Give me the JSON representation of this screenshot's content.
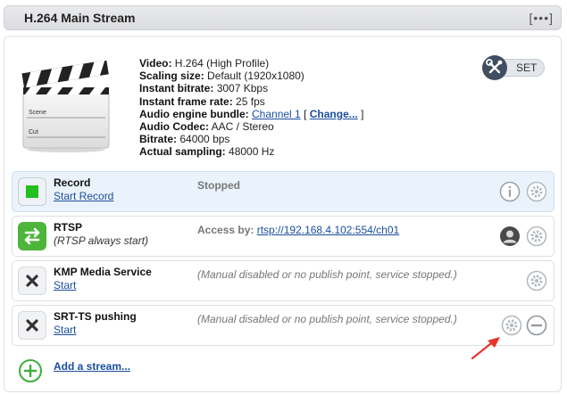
{
  "header": {
    "title": "H.264 Main Stream",
    "menu": "[•••]"
  },
  "clapper": {
    "scene": "Scene",
    "cut": "Cut"
  },
  "info": {
    "video_label": "Video:",
    "video_value": "H.264 (High Profile)",
    "scaling_label": "Scaling size:",
    "scaling_value": "Default (1920x1080)",
    "bitrate_label": "Instant bitrate:",
    "bitrate_value": "3007 Kbps",
    "framerate_label": "Instant frame rate:",
    "framerate_value": "25 fps",
    "audio_bundle_label": "Audio engine bundle:",
    "audio_bundle_link": "Channel 1",
    "audio_bundle_open": "[",
    "audio_bundle_change": "Change...",
    "audio_bundle_close": "]",
    "audio_codec_label": "Audio Codec:",
    "audio_codec_value": "AAC / Stereo",
    "abitrate_label": "Bitrate:",
    "abitrate_value": "64000 bps",
    "sampling_label": "Actual sampling:",
    "sampling_value": "48000 Hz"
  },
  "set_button": {
    "label": "SET"
  },
  "streams": [
    {
      "name": "Record",
      "action": "Start Record",
      "status": "Stopped"
    },
    {
      "name": "RTSP",
      "sub": "(RTSP always start)",
      "status_label": "Access by:",
      "status_link": "rtsp://192.168.4.102:554/ch01"
    },
    {
      "name": "KMP Media Service",
      "action": "Start",
      "status": "(Manual disabled or no publish point, service stopped.)"
    },
    {
      "name": "SRT-TS pushing",
      "action": "Start",
      "status": "(Manual disabled or no publish point, service stopped.)"
    }
  ],
  "add_stream": {
    "label": "Add a stream..."
  },
  "colors": {
    "record_green": "#22c01e",
    "rtsp_green": "#4cb53a",
    "link": "#1a4d9e",
    "annotation_red": "#e8342c"
  }
}
